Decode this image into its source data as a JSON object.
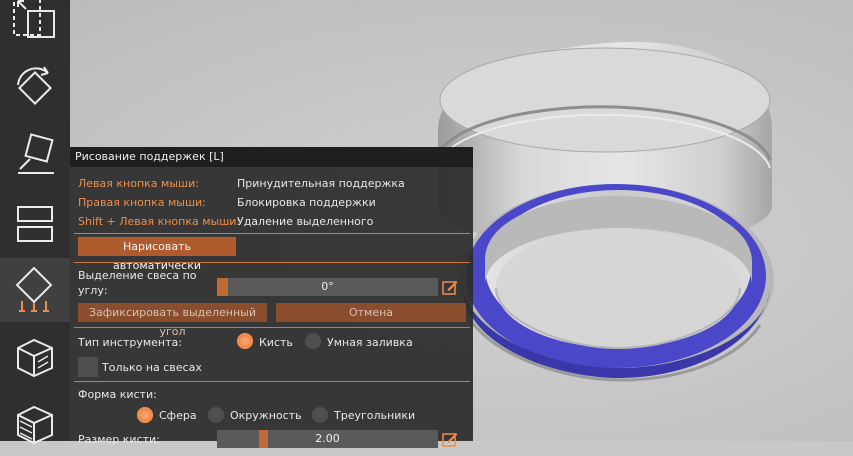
{
  "panel": {
    "title": "Рисование поддержек [L]",
    "hints": [
      {
        "action": "Левая кнопка мыши:",
        "effect": "Принудительная поддержка"
      },
      {
        "action": "Правая кнопка мыши:",
        "effect": "Блокировка поддержки"
      },
      {
        "action": "Shift + Левая кнопка мыши:",
        "effect": "Удаление выделенного"
      }
    ],
    "auto_paint_label": "Нарисовать автоматически",
    "overhang_label_line1": "Выделение свеса по",
    "overhang_label_line2": "углу:",
    "overhang_value": "0°",
    "overhang_fraction": 0.05,
    "lock_angle_label": "Зафиксировать выделенный угол",
    "cancel_label": "Отмена",
    "tool_type_label": "Тип инструмента:",
    "tool_brush": "Кисть",
    "tool_smart_fill": "Умная заливка",
    "only_overhangs_label": "Только на свесах",
    "brush_shape_label": "Форма кисти:",
    "shape_sphere": "Сфера",
    "shape_circle": "Окружность",
    "shape_triangles": "Треугольники",
    "brush_size_label": "Размер кисти:",
    "brush_size_value": "2.00",
    "brush_size_fraction": 0.2
  },
  "toolbar": {
    "tools": [
      "scale-icon",
      "rotate-icon",
      "place-on-face-icon",
      "cut-icon",
      "support-paint-icon",
      "seam-paint-icon",
      "mmu-paint-icon"
    ],
    "active_tool": "support-paint-icon"
  },
  "colors": {
    "accent": "#f08d4a",
    "button": "#b05b2e",
    "paint_blue": "#4a47c8"
  }
}
